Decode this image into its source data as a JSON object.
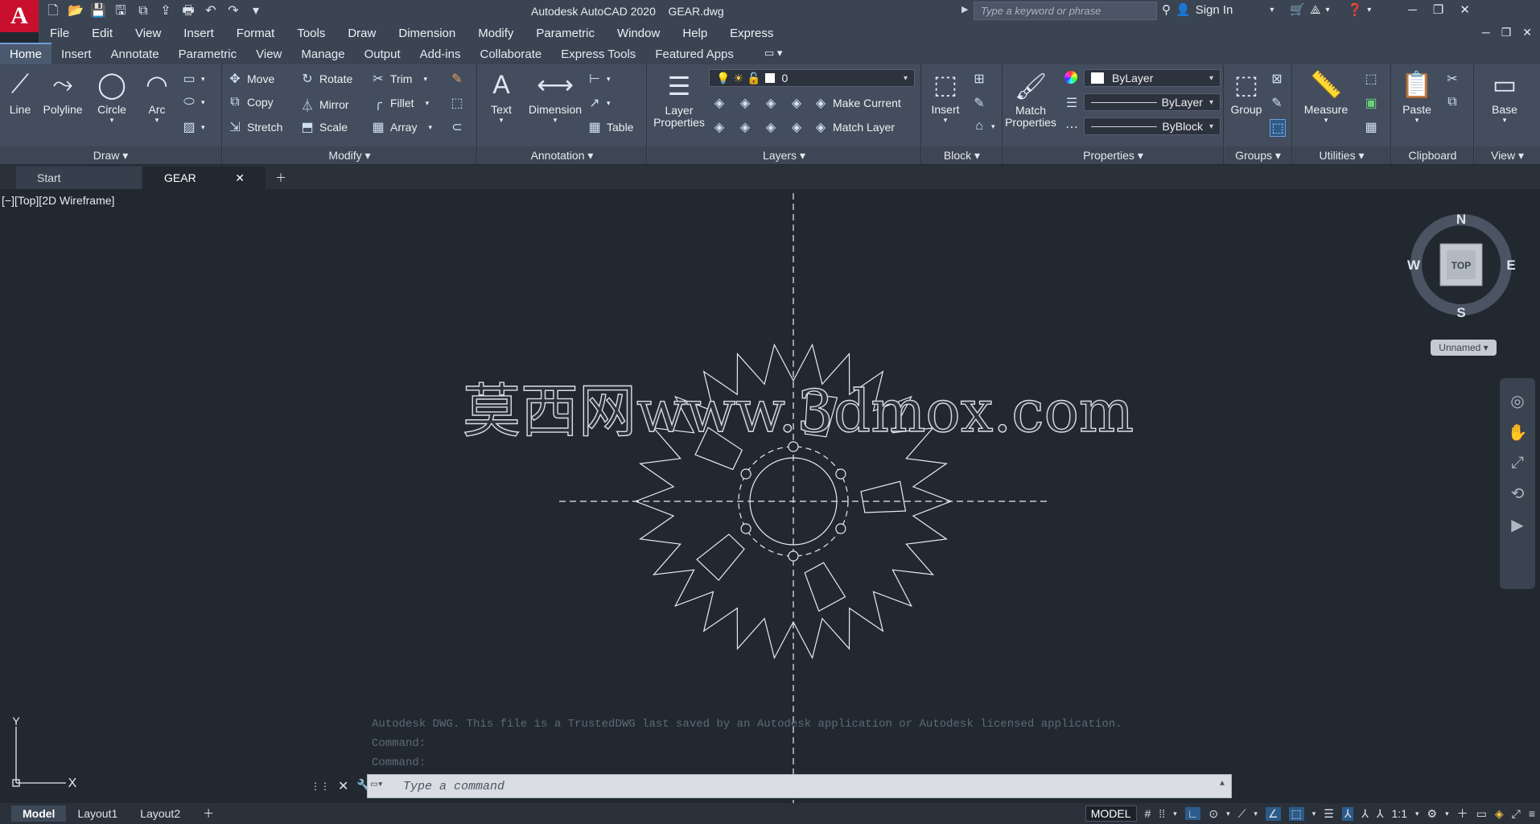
{
  "app": {
    "title": "Autodesk AutoCAD 2020",
    "document": "GEAR.dwg",
    "logo": "A"
  },
  "search": {
    "placeholder": "Type a keyword or phrase"
  },
  "account": {
    "signin": "Sign In"
  },
  "menu": [
    "File",
    "Edit",
    "View",
    "Insert",
    "Format",
    "Tools",
    "Draw",
    "Dimension",
    "Modify",
    "Parametric",
    "Window",
    "Help",
    "Express"
  ],
  "ribbon_tabs": [
    "Home",
    "Insert",
    "Annotate",
    "Parametric",
    "View",
    "Manage",
    "Output",
    "Add-ins",
    "Collaborate",
    "Express Tools",
    "Featured Apps"
  ],
  "draw": {
    "line": "Line",
    "polyline": "Polyline",
    "circle": "Circle",
    "arc": "Arc",
    "panel": "Draw ▾"
  },
  "modify": {
    "move": "Move",
    "rotate": "Rotate",
    "trim": "Trim",
    "copy": "Copy",
    "mirror": "Mirror",
    "fillet": "Fillet",
    "stretch": "Stretch",
    "scale": "Scale",
    "array": "Array",
    "panel": "Modify ▾"
  },
  "annotation": {
    "text": "Text",
    "dimension": "Dimension",
    "table": "Table",
    "panel": "Annotation ▾"
  },
  "layers": {
    "properties": "Layer\nProperties",
    "current_layer": "0",
    "make_current": "Make Current",
    "match_layer": "Match Layer",
    "panel": "Layers ▾"
  },
  "block": {
    "insert": "Insert",
    "panel": "Block ▾"
  },
  "properties": {
    "match": "Match\nProperties",
    "color": "ByLayer",
    "linetype": "ByLayer",
    "lineweight": "ByBlock",
    "panel": "Properties ▾"
  },
  "groups": {
    "group": "Group",
    "panel": "Groups ▾"
  },
  "utilities": {
    "measure": "Measure",
    "panel": "Utilities ▾"
  },
  "clipboard": {
    "paste": "Paste",
    "panel": "Clipboard"
  },
  "viewpanel": {
    "base": "Base",
    "panel": "View ▾"
  },
  "doc_tabs": {
    "start": "Start",
    "gear": "GEAR"
  },
  "viewport": {
    "label": "[−][Top][2D Wireframe]"
  },
  "viewcube": {
    "n": "N",
    "s": "S",
    "e": "E",
    "w": "W",
    "face": "TOP",
    "ucs": "Unnamed"
  },
  "watermark": "莫西网www.3dmox.com",
  "ucs": {
    "x": "X",
    "y": "Y"
  },
  "command": {
    "history": [
      "Autodesk DWG.  This file is a TrustedDWG last saved by an Autodesk application or Autodesk licensed application.",
      "Command:",
      "Command:"
    ],
    "placeholder": "Type a command"
  },
  "layout_tabs": [
    "Model",
    "Layout1",
    "Layout2"
  ],
  "status": {
    "model": "MODEL",
    "scale": "1:1"
  },
  "colors": {
    "accent": "#c8102e",
    "background": "#212830",
    "ribbon": "#434d5d"
  }
}
